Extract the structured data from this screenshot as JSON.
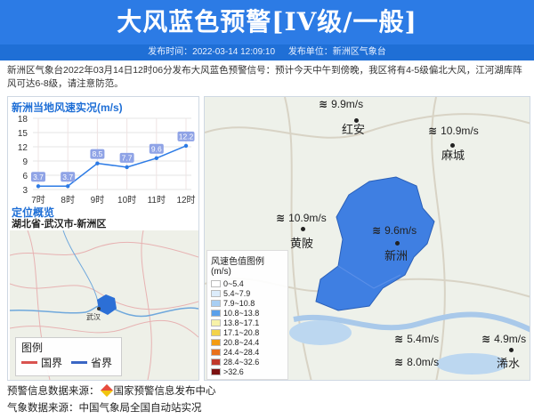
{
  "header": {
    "title": "大风蓝色预警[IV级/一般]"
  },
  "subbar": {
    "time_label": "发布时间：2022-03-14 12:09:10",
    "unit_label": "发布单位：新洲区气象台"
  },
  "description": "新洲区气象台2022年03月14日12时06分发布大风蓝色预警信号：预计今天中午到傍晚，我区将有4-5级偏北大风，江河湖库阵风可达6-8级，请注意防范。",
  "wind_section": {
    "title": "新洲当地风速实况(m/s)"
  },
  "chart_data": {
    "type": "line",
    "categories": [
      "7时",
      "8时",
      "9时",
      "10时",
      "11时",
      "12时"
    ],
    "values": [
      3.7,
      3.7,
      8.5,
      7.7,
      9.6,
      12.2
    ],
    "value_labels": [
      "3.7",
      "3.7",
      "8.5",
      "7.7",
      "9.6",
      "12.2"
    ],
    "yticks": [
      "18",
      "15",
      "12",
      "9",
      "6",
      "3"
    ],
    "ylim": [
      3,
      18
    ],
    "line_color": "#2c7be5",
    "grid": true
  },
  "location": {
    "title": "定位概览",
    "path": "湖北省-武汉市-新洲区"
  },
  "minimap": {
    "city_label": "武汉",
    "legend_title": "图例",
    "legend": [
      {
        "label": "国界",
        "color": "#d9534f"
      },
      {
        "label": "省界",
        "color": "#3a66c4"
      }
    ]
  },
  "map": {
    "wind_labels": [
      {
        "text": "9.9m/s",
        "style": "wl-light"
      },
      {
        "text": "10.9m/s",
        "style": "wl-blue"
      },
      {
        "text": "10.9m/s",
        "style": "wl-blue"
      },
      {
        "text": "9.6m/s",
        "style": "wl-light"
      },
      {
        "text": "5.4m/s",
        "style": "wl-light"
      },
      {
        "text": "8.0m/s",
        "style": "wl-light"
      },
      {
        "text": "4.9m/s",
        "style": "wl-white"
      }
    ],
    "cities": [
      "红安",
      "麻城",
      "黄陂",
      "新洲",
      "浠水"
    ],
    "scale_title": "风速色值图例 (m/s)",
    "scale": [
      {
        "label": "0~5.4",
        "color": "#ffffff"
      },
      {
        "label": "5.4~7.9",
        "color": "#dcecfb"
      },
      {
        "label": "7.9~10.8",
        "color": "#a9cff3"
      },
      {
        "label": "10.8~13.8",
        "color": "#5aa0ea"
      },
      {
        "label": "13.8~17.1",
        "color": "#f7f2a8"
      },
      {
        "label": "17.1~20.8",
        "color": "#f3d34a"
      },
      {
        "label": "20.8~24.4",
        "color": "#f39c12"
      },
      {
        "label": "24.4~28.4",
        "color": "#e8711c"
      },
      {
        "label": "28.4~32.6",
        "color": "#c0392b"
      },
      {
        "label": ">32.6",
        "color": "#7b1010"
      }
    ]
  },
  "footer": {
    "line1_prefix": "预警信息数据来源：",
    "line1_source": "国家预警信息发布中心",
    "line2": "气象数据来源：中国气象局全国自动站实况"
  }
}
